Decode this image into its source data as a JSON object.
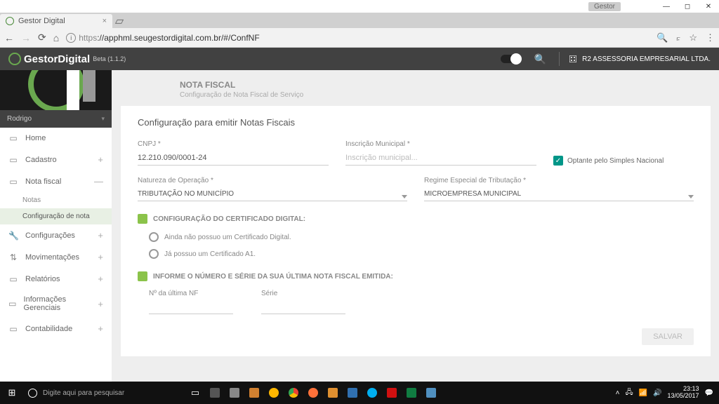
{
  "window": {
    "gestor_tag": "Gestor",
    "tab_title": "Gestor Digital"
  },
  "browser": {
    "url_proto": "https",
    "url_rest": "://apphml.seugestordigital.com.br/#/ConfNF"
  },
  "header": {
    "brand": "GestorDigital",
    "beta": "Beta (1.1.2)",
    "company": "R2 ASSESSORIA EMPRESARIAL LTDA."
  },
  "sidebar": {
    "user": "Rodrigo",
    "items": [
      {
        "label": "Home",
        "icon": "▭"
      },
      {
        "label": "Cadastro",
        "icon": "▭",
        "expand": "+"
      },
      {
        "label": "Nota fiscal",
        "icon": "▭",
        "expand": "—"
      },
      {
        "label": "Configurações",
        "icon": "🔧",
        "expand": "+"
      },
      {
        "label": "Movimentações",
        "icon": "⇅",
        "expand": "+"
      },
      {
        "label": "Relatórios",
        "icon": "▭",
        "expand": "+"
      },
      {
        "label": "Informações Gerenciais",
        "icon": "▭",
        "expand": "+"
      },
      {
        "label": "Contabilidade",
        "icon": "▭",
        "expand": "+"
      }
    ],
    "subitems": [
      "Notas",
      "Configuração de nota"
    ]
  },
  "page": {
    "heading": "NOTA FISCAL",
    "subheading": "Configuração de Nota Fiscal de Serviço",
    "panel_title": "Configuração para emitir Notas Fiscais",
    "fields": {
      "cnpj_label": "CNPJ *",
      "cnpj_value": "12.210.090/0001-24",
      "inscricao_label": "Inscrição Municipal *",
      "inscricao_placeholder": "Inscrição municipal...",
      "optante_label": "Optante pelo Simples Nacional",
      "natureza_label": "Natureza de Operação *",
      "natureza_value": "TRIBUTAÇÃO NO MUNICÍPIO",
      "regime_label": "Regime Especial de Tributação *",
      "regime_value": "MICROEMPRESA MUNICIPAL"
    },
    "cert_section": "CONFIGURAÇÃO DO CERTIFICADO DIGITAL:",
    "cert_opt1": "Ainda não possuo um Certificado Digital.",
    "cert_opt2": "Já possuo um Certificado A1.",
    "nf_section": "INFORME O NÚMERO E SÉRIE DA SUA ÚLTIMA NOTA FISCAL EMITIDA:",
    "nf_num_label": "Nº da última NF",
    "nf_serie_label": "Série",
    "save_btn": "SALVAR"
  },
  "taskbar": {
    "search_placeholder": "Digite aqui para pesquisar",
    "time": "23:13",
    "date": "13/05/2017"
  }
}
